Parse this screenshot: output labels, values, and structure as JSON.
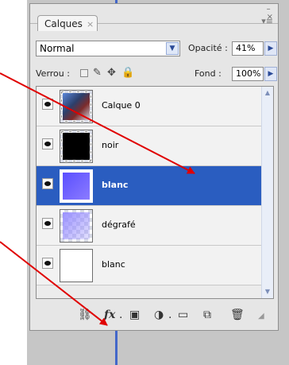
{
  "panel": {
    "tab_label": "Calques",
    "tab_close": "×",
    "menu_glyph": "▾≡",
    "window_minimize": "–",
    "window_close": "×"
  },
  "blend": {
    "mode": "Normal",
    "opacity_label": "Opacité :",
    "opacity_value": "41%"
  },
  "lock": {
    "label": "Verrou :",
    "fill_label": "Fond :",
    "fill_value": "100%"
  },
  "layers": [
    {
      "name": "Calque 0",
      "visible": true,
      "selected": false
    },
    {
      "name": "noir",
      "visible": true,
      "selected": false
    },
    {
      "name": "blanc",
      "visible": true,
      "selected": true
    },
    {
      "name": "dégrafé",
      "visible": true,
      "selected": false
    },
    {
      "name": "blanc",
      "visible": true,
      "selected": false
    }
  ],
  "toolbar": {
    "link_icon": "link-layers-icon",
    "fx_label": "fx",
    "mask_icon": "add-mask-icon",
    "adjustment_icon": "adjustment-layer-icon",
    "group_icon": "new-group-icon",
    "new_layer_icon": "new-layer-icon",
    "delete_icon": "delete-layer-icon"
  },
  "colors": {
    "selected_row": "#2a5dc0",
    "annotation_arrow": "#e00000"
  }
}
